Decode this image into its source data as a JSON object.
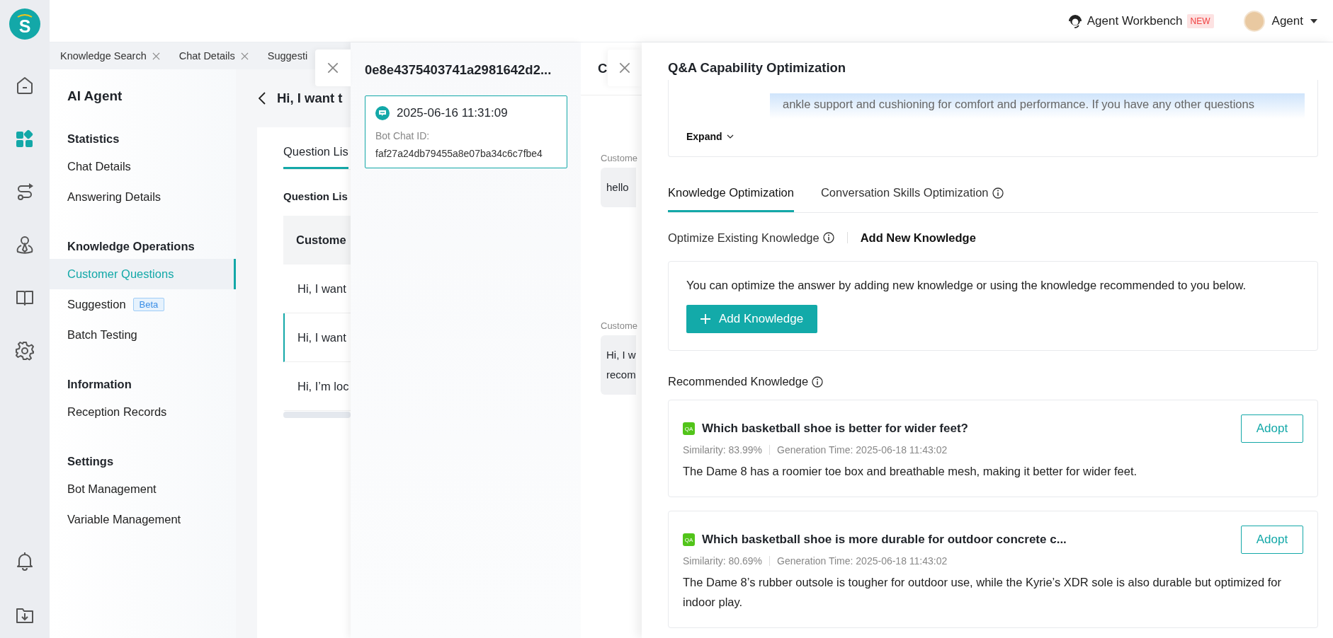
{
  "rail": {
    "logo": "S",
    "items": [
      {
        "kind": "home",
        "selected": false
      },
      {
        "kind": "apps",
        "selected": true
      },
      {
        "kind": "flow",
        "selected": false
      },
      {
        "kind": "agent",
        "selected": false
      },
      {
        "kind": "book",
        "selected": false
      },
      {
        "kind": "gear",
        "selected": false
      }
    ],
    "bottom_items": [
      {
        "kind": "bell",
        "selected": false
      },
      {
        "kind": "download",
        "selected": false
      }
    ]
  },
  "topbar": {
    "workbench": "Agent Workbench",
    "badge": "NEW",
    "user": "Agent"
  },
  "page_tabs": [
    {
      "label": "Knowledge Search",
      "closable": true
    },
    {
      "label": "Chat Details",
      "closable": true
    },
    {
      "label": "Suggesti",
      "closable": false
    }
  ],
  "nav": {
    "title": "AI Agent",
    "sections": [
      {
        "heading": "Statistics",
        "items": [
          {
            "label": "Chat Details",
            "selected": false
          },
          {
            "label": "Answering Details",
            "selected": false
          }
        ]
      },
      {
        "heading": "Knowledge Operations",
        "items": [
          {
            "label": "Customer Questions",
            "selected": true
          },
          {
            "label": "Suggestion",
            "selected": false,
            "badge": "Beta"
          },
          {
            "label": "Batch Testing",
            "selected": false
          }
        ]
      },
      {
        "heading": "Information",
        "items": [
          {
            "label": "Reception Records",
            "selected": false
          }
        ]
      },
      {
        "heading": "Settings",
        "items": [
          {
            "label": "Bot Management",
            "selected": false
          },
          {
            "label": "Variable Management",
            "selected": false
          }
        ]
      }
    ]
  },
  "content": {
    "title": "Hi, I want t",
    "tabs": [
      {
        "label": "Question Lis",
        "selected": true
      }
    ],
    "section_title": "Question Lis",
    "table": {
      "columns": [
        "Custome"
      ],
      "rows": [
        {
          "cells": [
            "Hi, I want"
          ],
          "selected": false
        },
        {
          "cells": [
            "Hi, I want"
          ],
          "selected": true
        },
        {
          "cells": [
            "Hi, I’m loc"
          ],
          "selected": false
        }
      ]
    }
  },
  "chat_drawer": {
    "title": "0e8e4375403741a2981642d2...",
    "sessions": [
      {
        "time": "2025-06-16 11:31:09",
        "id_label": "Bot Chat ID:",
        "id": "faf27a24db79455a8e07ba34c6c7fbe4",
        "selected": true
      }
    ]
  },
  "conversation_drawer": {
    "title": "C",
    "messages": [
      {
        "sender": "Custome",
        "text": "hello"
      },
      {
        "sender": "Custome",
        "text": "Hi, I w\nrecom"
      }
    ]
  },
  "optimization_drawer": {
    "title": "Q&A Capability Optimization",
    "answer_excerpt": "ankle support and cushioning for comfort and performance. If you have any other questions",
    "expand": "Expand",
    "tabs": [
      {
        "label": "Knowledge Optimization",
        "selected": true,
        "info": false
      },
      {
        "label": "Conversation Skills Optimization",
        "selected": false,
        "info": true
      }
    ],
    "subtabs": [
      {
        "label": "Optimize Existing Knowledge",
        "selected": false,
        "info": true
      },
      {
        "label": "Add New Knowledge",
        "selected": true,
        "info": false
      }
    ],
    "add_panel": {
      "hint": "You can optimize the answer by adding new knowledge or using the knowledge recommended to you below.",
      "button": "Add Knowledge"
    },
    "recommended": {
      "heading": "Recommended Knowledge",
      "items": [
        {
          "badge": "QA",
          "question": "Which basketball shoe is better for wider feet?",
          "similarity": "Similarity: 83.99%",
          "time": "Generation Time: 2025-06-18 11:43:02",
          "answer": "The Dame 8 has a roomier toe box and breathable mesh, making it better for wider feet.",
          "action": "Adopt"
        },
        {
          "badge": "QA",
          "question": "Which basketball shoe is more durable for outdoor concrete c...",
          "similarity": "Similarity: 80.69%",
          "time": "Generation Time: 2025-06-18 11:43:02",
          "answer": "The Dame 8’s rubber outsole is tougher for outdoor use, while the Kyrie’s XDR sole is also durable but optimized for indoor play.",
          "action": "Adopt"
        }
      ]
    }
  }
}
